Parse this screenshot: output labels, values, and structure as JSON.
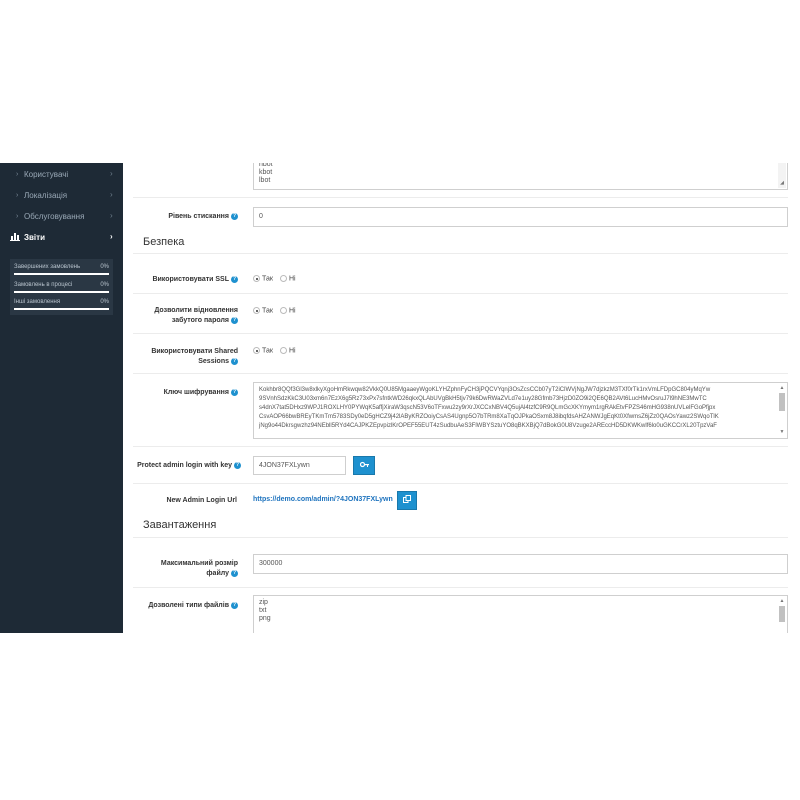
{
  "sidebar": {
    "items": [
      {
        "label": "Користувачі"
      },
      {
        "label": "Локалізація"
      },
      {
        "label": "Обслуговування"
      }
    ],
    "reports": {
      "label": "Звіти"
    },
    "stats": [
      {
        "label": "Завершених замовлень",
        "value": "0%",
        "progress": 0
      },
      {
        "label": "Замовлень в процесі",
        "value": "0%",
        "progress": 0
      },
      {
        "label": "Інші замовлення",
        "value": "0%",
        "progress": 0
      }
    ]
  },
  "robots": {
    "lines": [
      "hbot",
      "kbot",
      "lbot"
    ]
  },
  "compression": {
    "label": "Рівень стискання",
    "value": "0"
  },
  "security": {
    "title": "Безпека",
    "use_ssl": {
      "label": "Використовувати SSL",
      "yes": "Так",
      "no": "Ні",
      "selected": "yes"
    },
    "password_reset": {
      "label_line1": "Дозволити відновлення",
      "label_line2": "забутого пароля",
      "yes": "Так",
      "no": "Ні",
      "selected": "yes"
    },
    "shared_sessions": {
      "label_line1": "Використовувати Shared",
      "label_line2": "Sessions",
      "yes": "Так",
      "no": "Ні",
      "selected": "yes"
    },
    "encryption_key": {
      "label": "Ключ шифрування",
      "lines": [
        "Kokhbr8QQf3Gl3w8xlkyXgoHmRkwqw82VkkQ0U85MgaaeyWgoKLYHZphnFyCH3jPQCVYqnj3OsZcsCCb07yT2iClWVjNgJW7djzkzM3TXf0rTk1rxVmLFDpGC804yMqYw",
        "9SVnhSdzKkC3U03xm6n7EzX6g5Rz73xPx7sfntkWD26qkxQLAbUVgBkH5tjv79k6DwRWaZVLd7e1uy28Gfmb73HjzD0ZO9i2QE6QB2AVt6LucHMvOsruJ7l9hNE3MwTC",
        "s4dnX7tat5DHxz9WPJ1ROXLHY0PYWqK5affjXiraW3qscN53V6oTFxwu2zy9rXrJXCCxNBV4Q5ujAl4tzfC9R9QLmGcXKYmym1rgRAkEtvFPZS46mHG938nUVLelFGoPfjpx",
        "CsvAOP66bwBREyTKmTm5783SDy0eD5gHCZ9j42lAByKRZOoiyCsAS4Ugnp5O7bTRm8XaTqOJPkaOSxm8J8ibqfdsAHZANWJgEqKt0XfwmsZ6jZz0QAOsYawz2SWqoTlK",
        "jNg9o44Dkrsgwzhz94NEbll5RYd4CAJPKZEpvpizlKrOPEF55EUT4zSudbuAeS3FlWBYSztuYO8qBKXBjQ7dBokG0U8Vzuge2AREccHD5DKWKwlf6lo0uGKCCrXL20TpzVaF"
      ]
    },
    "protect_admin": {
      "label": "Protect admin login with key",
      "value": "4JON37FXLywn",
      "button_icon": "key-icon"
    },
    "new_admin_url": {
      "label": "New Admin Login Url",
      "value": "https://demo.com/admin/?4JON37FXLywn",
      "button_icon": "copy-icon"
    }
  },
  "uploads": {
    "title": "Завантаження",
    "max_size": {
      "label_line1": "Максимальний розмір",
      "label_line2": "файлу",
      "value": "300000"
    },
    "allowed_types": {
      "label": "Дозволені типи файлів",
      "lines": [
        "zip",
        "txt",
        "png"
      ]
    }
  },
  "colors": {
    "sidebar_bg": "#1e2a36",
    "accent": "#1e91cf",
    "link": "#1e73be"
  }
}
